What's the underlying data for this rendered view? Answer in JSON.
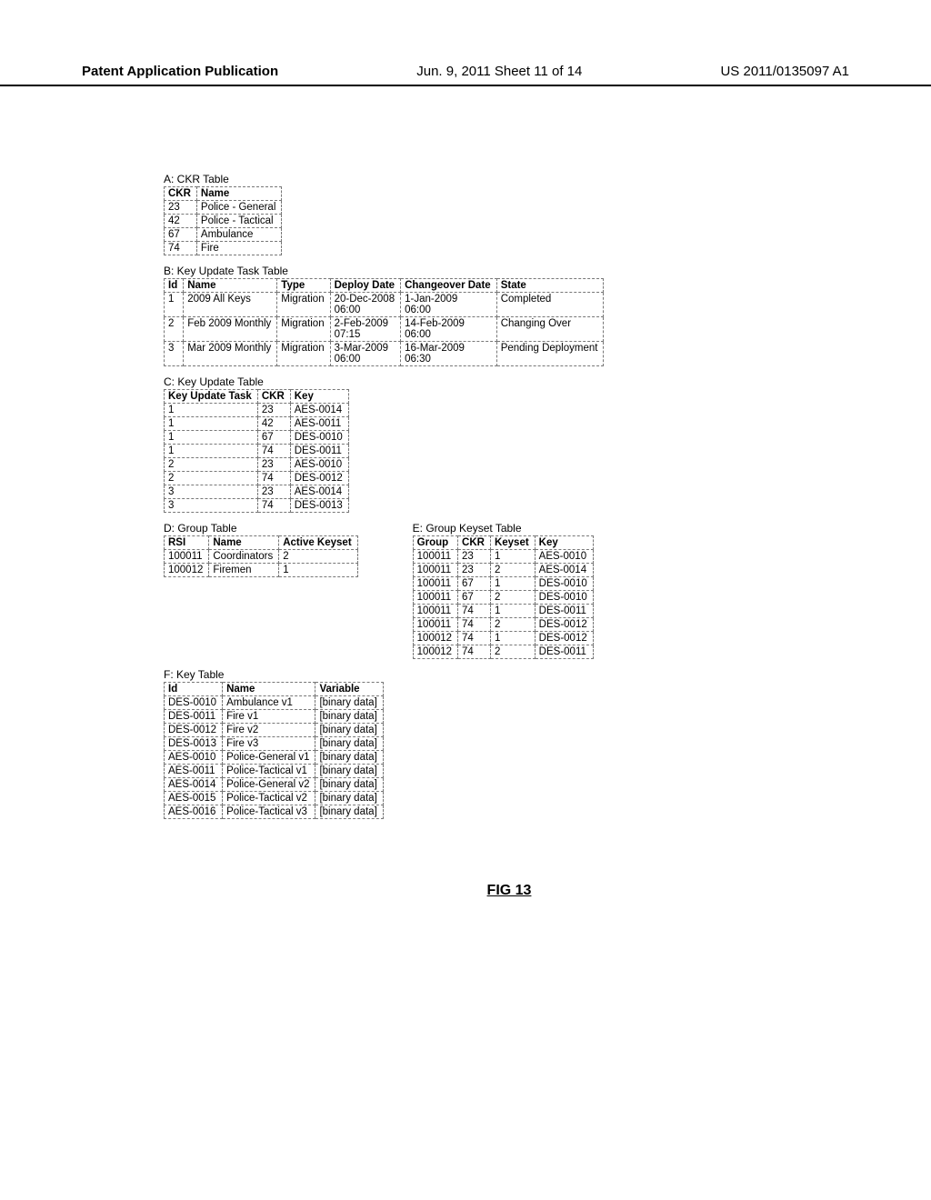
{
  "header": {
    "left": "Patent Application Publication",
    "center": "Jun. 9, 2011  Sheet 11 of 14",
    "right": "US 2011/0135097 A1"
  },
  "tableA": {
    "title": "A: CKR Table",
    "headers": [
      "CKR",
      "Name"
    ],
    "rows": [
      [
        "23",
        "Police - General"
      ],
      [
        "42",
        "Police - Tactical"
      ],
      [
        "67",
        "Ambulance"
      ],
      [
        "74",
        "Fire"
      ]
    ]
  },
  "tableB": {
    "title": "B: Key Update Task Table",
    "headers": [
      "Id",
      "Name",
      "Type",
      "Deploy Date",
      "Changeover Date",
      "State"
    ],
    "rows": [
      [
        "1",
        "2009 All Keys",
        "Migration",
        "20-Dec-2008\n06:00",
        "1-Jan-2009\n06:00",
        "Completed"
      ],
      [
        "2",
        "Feb 2009 Monthly",
        "Migration",
        "2-Feb-2009\n07:15",
        "14-Feb-2009\n06:00",
        "Changing Over"
      ],
      [
        "3",
        "Mar 2009 Monthly",
        "Migration",
        "3-Mar-2009\n06:00",
        "16-Mar-2009\n06:30",
        "Pending Deployment"
      ]
    ]
  },
  "tableC": {
    "title": "C: Key Update Table",
    "headers": [
      "Key Update Task",
      "CKR",
      "Key"
    ],
    "rows": [
      [
        "1",
        "23",
        "AES-0014"
      ],
      [
        "1",
        "42",
        "AES-0011"
      ],
      [
        "1",
        "67",
        "DES-0010"
      ],
      [
        "1",
        "74",
        "DES-0011"
      ],
      [
        "2",
        "23",
        "AES-0010"
      ],
      [
        "2",
        "74",
        "DES-0012"
      ],
      [
        "3",
        "23",
        "AES-0014"
      ],
      [
        "3",
        "74",
        "DES-0013"
      ]
    ]
  },
  "tableD": {
    "title": "D: Group Table",
    "headers": [
      "RSI",
      "Name",
      "Active Keyset"
    ],
    "rows": [
      [
        "100011",
        "Coordinators",
        "2"
      ],
      [
        "100012",
        "Firemen",
        "1"
      ]
    ]
  },
  "tableE": {
    "title": "E: Group Keyset Table",
    "headers": [
      "Group",
      "CKR",
      "Keyset",
      "Key"
    ],
    "rows": [
      [
        "100011",
        "23",
        "1",
        "AES-0010"
      ],
      [
        "100011",
        "23",
        "2",
        "AES-0014"
      ],
      [
        "100011",
        "67",
        "1",
        "DES-0010"
      ],
      [
        "100011",
        "67",
        "2",
        "DES-0010"
      ],
      [
        "100011",
        "74",
        "1",
        "DES-0011"
      ],
      [
        "100011",
        "74",
        "2",
        "DES-0012"
      ],
      [
        "100012",
        "74",
        "1",
        "DES-0012"
      ],
      [
        "100012",
        "74",
        "2",
        "DES-0011"
      ]
    ]
  },
  "tableF": {
    "title": "F: Key Table",
    "headers": [
      "Id",
      "Name",
      "Variable"
    ],
    "rows": [
      [
        "DES-0010",
        "Ambulance v1",
        "[binary data]"
      ],
      [
        "DES-0011",
        "Fire v1",
        "[binary data]"
      ],
      [
        "DES-0012",
        "Fire v2",
        "[binary data]"
      ],
      [
        "DES-0013",
        "Fire v3",
        "[binary data]"
      ],
      [
        "AES-0010",
        "Police-General v1",
        "[binary data]"
      ],
      [
        "AES-0011",
        "Police-Tactical v1",
        "[binary data]"
      ],
      [
        "AES-0014",
        "Police-General v2",
        "[binary data]"
      ],
      [
        "AES-0015",
        "Police-Tactical v2",
        "[binary data]"
      ],
      [
        "AES-0016",
        "Police-Tactical v3",
        "[binary data]"
      ]
    ]
  },
  "figure": "FIG 13"
}
